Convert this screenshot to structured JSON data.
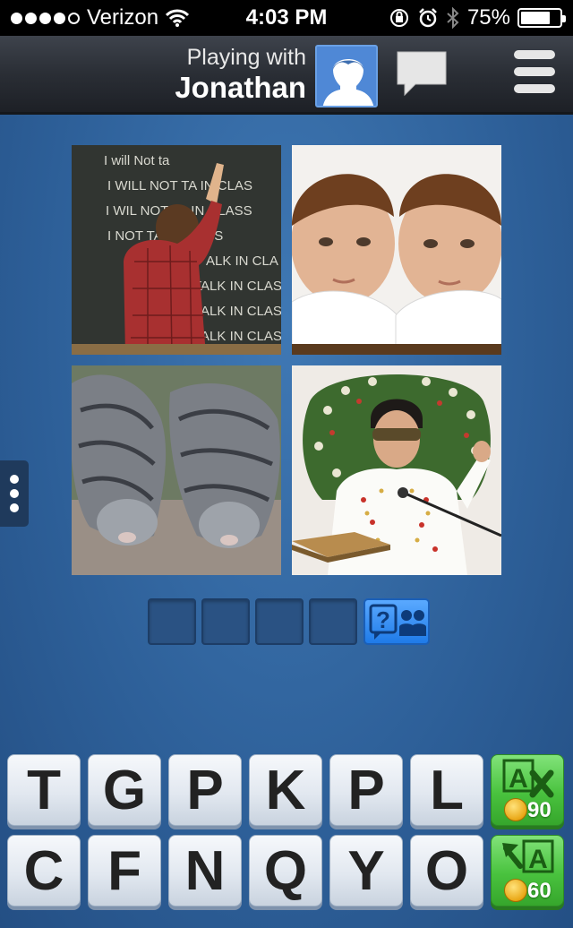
{
  "status_bar": {
    "carrier": "Verizon",
    "time": "4:03 PM",
    "battery": "75%",
    "battery_level": 0.75
  },
  "header": {
    "playing_with": "Playing with",
    "player_name": "Jonathan"
  },
  "photos": [
    {
      "subject": "boy writing on chalkboard",
      "chalk_lines": [
        "I will  Not  ta",
        "I WILL NOT TA  IN CLAS",
        "I WIL  NOT TA  IN CLASS",
        "I  NOT TA  N CLASS",
        "ALK IN CLA",
        "TALK IN CLASS",
        "TALK IN CLASS",
        "TALK IN CLASS"
      ]
    },
    {
      "subject": "twin boys"
    },
    {
      "subject": "two tabby kittens"
    },
    {
      "subject": "man in white jumpsuit with book"
    }
  ],
  "answer": {
    "slots": [
      "",
      "",
      "",
      ""
    ]
  },
  "keyboard": {
    "row1": [
      "T",
      "G",
      "P",
      "K",
      "P",
      "L"
    ],
    "row2": [
      "C",
      "F",
      "N",
      "Q",
      "Y",
      "O"
    ]
  },
  "powerups": {
    "remove_letters_price": "90",
    "reveal_letter_price": "60"
  },
  "colors": {
    "background": "#2d5f98",
    "powerup_green": "#49c23e",
    "hint_blue": "#1f7be8"
  }
}
